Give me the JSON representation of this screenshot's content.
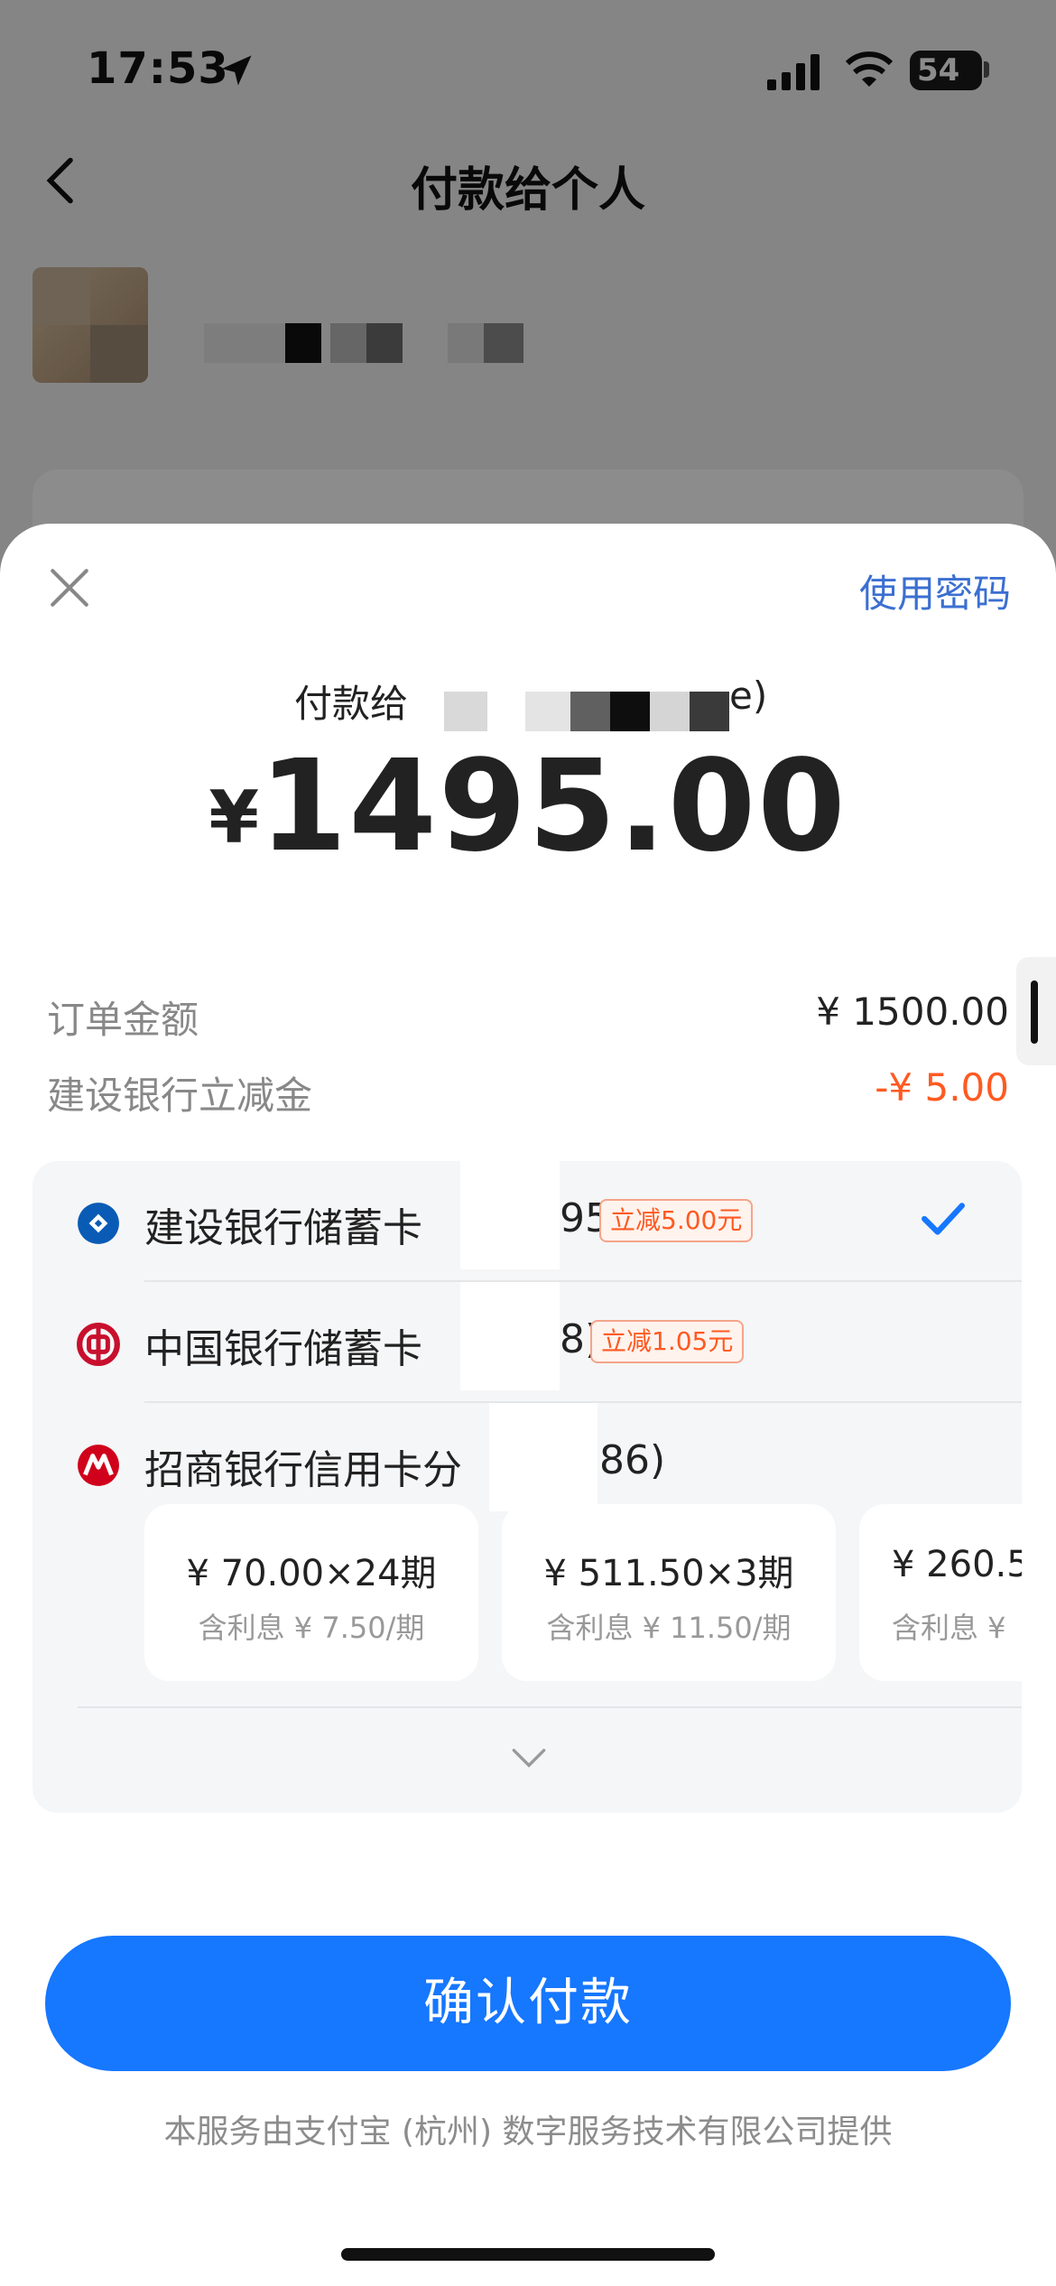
{
  "status_bar": {
    "time": "17:53",
    "battery": "54"
  },
  "nav": {
    "title": "付款给个人"
  },
  "sheet": {
    "use_password": "使用密码",
    "pay_to_prefix": "付款给",
    "pay_to_suffix": "e)",
    "currency": "¥",
    "amount": "1495.00",
    "order_label": "订单金额",
    "order_value": "¥ 1500.00",
    "discount_label": "建设银行立减金",
    "discount_value": "-¥ 5.00"
  },
  "methods": [
    {
      "name": "建设银行储蓄卡",
      "suffix": "95)",
      "promo": "立减5.00元",
      "selected": true,
      "icon": "ccb-bank-icon"
    },
    {
      "name": "中国银行储蓄卡",
      "suffix": "8)",
      "promo": "立减1.05元",
      "selected": false,
      "icon": "boc-bank-icon"
    },
    {
      "name": "招商银行信用卡分",
      "suffix": "86)",
      "promo": "",
      "selected": false,
      "icon": "cmb-bank-icon"
    }
  ],
  "installments": [
    {
      "main": "¥ 70.00×24期",
      "sub": "含利息 ¥ 7.50/期"
    },
    {
      "main": "¥ 511.50×3期",
      "sub": "含利息 ¥ 11.50/期"
    },
    {
      "main": "¥ 260.5",
      "sub": "含利息 ¥"
    }
  ],
  "confirm_label": "确认付款",
  "footer": "本服务由支付宝 (杭州) 数字服务技术有限公司提供",
  "colors": {
    "primary": "#1677ff",
    "discount": "#ff5a22",
    "link": "#3b6fd1"
  }
}
